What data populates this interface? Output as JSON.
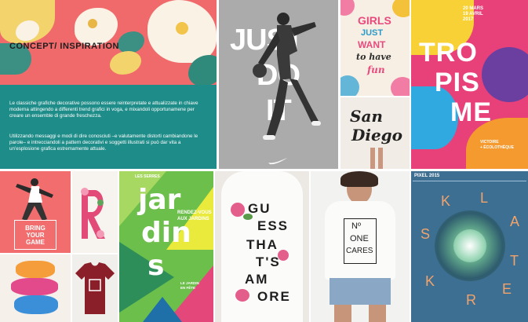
{
  "concept": {
    "title": "CONCEPT/ INSPIRATION",
    "para1": "Le classiche grafiche decorative possono essere reinterpretate e attualizzate in chiave moderna attingendo a differenti trend grafici in voga, e mixandoli opportunamene per creare un ensemble di grande freschezza.",
    "para2": "Utilizzando messaggi e modi di dire conosciuti –e valutamente distorti cambiandone le parole– e intrecciandoli a pattern decorativi e soggetti illustrati si può dar vita a un'esplosione grafica estremamente attuale."
  },
  "nike": {
    "line1": "JUST",
    "line2": "DO",
    "line3": "IT"
  },
  "girls": {
    "l1": "GIRLS",
    "l2": "JUST",
    "l3": "WANT",
    "l4": "to have",
    "l5": "fun"
  },
  "sandiego": {
    "l1": "San",
    "l2": "Diego"
  },
  "tropisme": {
    "date": "20 MARS\n19 AVRIL\n2017",
    "t1": "TRO",
    "t2": "PIS",
    "t3": "ME",
    "venue": "VICTOIRE\n+ ÉCOLOTHÈQUE"
  },
  "bringgame": {
    "l1": "BRING",
    "l2": "YOUR",
    "l3": "GAME"
  },
  "jardins": {
    "header": "LES SERRES",
    "j1": "jar",
    "j2": "din",
    "j3": "s",
    "rdv1": "RENDEZ-VOUS",
    "rdv2": "AUX JARDINS",
    "info": "LE JARDIN\nEN FÊTE"
  },
  "guess": {
    "l1": "GU",
    "l2": "ESS",
    "l3": "THA",
    "l4": "T'S",
    "l5": "AM",
    "l6": "ORE"
  },
  "noone": {
    "l1": "Nº",
    "l2": "ONE",
    "l3": "CARES"
  },
  "pixel": {
    "label": "PIXEL 2015",
    "letters": [
      "K",
      "L",
      "A",
      "S",
      "T",
      "E",
      "R",
      "K"
    ]
  },
  "colors": {
    "teal": "#1e8c88",
    "coral": "#f0706a",
    "nike_bg": "#a9a9a9",
    "tro_pink": "#e8417a",
    "tro_yellow": "#f7d135",
    "jardins_green": "#6bbf4a",
    "pixel_blue": "#3d6f93"
  }
}
